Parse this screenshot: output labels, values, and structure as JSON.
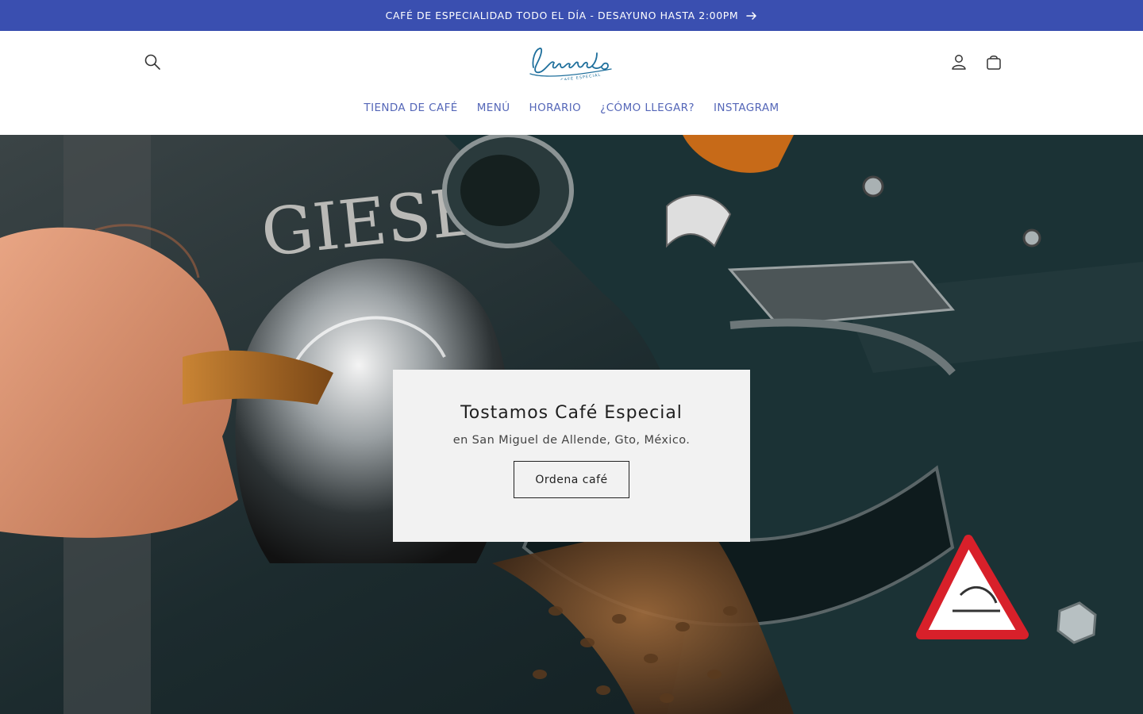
{
  "announcement": {
    "text": "CAFÉ DE ESPECIALIDAD TODO EL DÍA - DESAYUNO HASTA 2:00PM",
    "icon": "arrow-right-icon"
  },
  "header": {
    "logo": {
      "script": "Lavanda",
      "tagline": "CAFÉ ESPECIAL"
    },
    "icons": {
      "search": "search-icon",
      "account": "user-icon",
      "cart": "bag-icon"
    },
    "nav": [
      {
        "label": "TIENDA DE CAFÉ"
      },
      {
        "label": "MENÚ"
      },
      {
        "label": "HORARIO"
      },
      {
        "label": "¿CÓMO LLEGAR?"
      },
      {
        "label": "INSTAGRAM"
      }
    ]
  },
  "hero": {
    "title": "Tostamos Café Especial",
    "subtitle": "en San Miguel de Allende, Gto, México.",
    "cta_label": "Ordena café",
    "background_text": "GIESE"
  },
  "colors": {
    "announcement_bg": "#3a4fb0",
    "nav_text": "#5567b8",
    "logo": "#1e6f9c",
    "card_bg": "#f2f2f2"
  }
}
